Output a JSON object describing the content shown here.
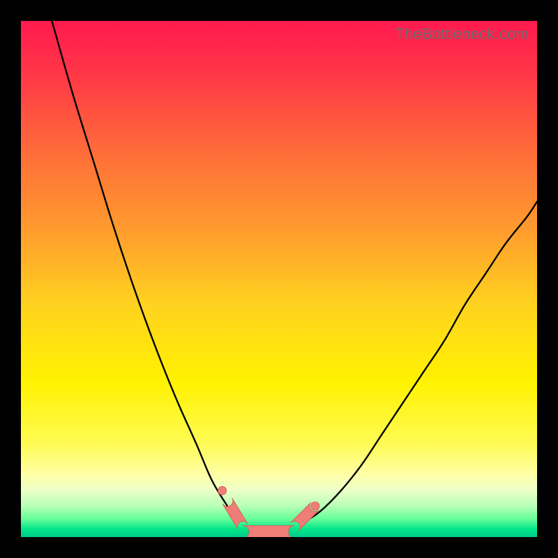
{
  "watermark": "TheBottleneck.com",
  "colors": {
    "frame": "#000000",
    "curve": "#000000",
    "sausage_fill": "#ef7d78",
    "sausage_stroke": "#d85f56",
    "gradient_stops": [
      {
        "offset": 0.0,
        "color": "#ff1a4f"
      },
      {
        "offset": 0.1,
        "color": "#ff3647"
      },
      {
        "offset": 0.25,
        "color": "#ff6b3a"
      },
      {
        "offset": 0.4,
        "color": "#ff9a2e"
      },
      {
        "offset": 0.55,
        "color": "#ffd21f"
      },
      {
        "offset": 0.7,
        "color": "#fff200"
      },
      {
        "offset": 0.82,
        "color": "#fffb55"
      },
      {
        "offset": 0.88,
        "color": "#ffffa8"
      },
      {
        "offset": 0.91,
        "color": "#ecffc8"
      },
      {
        "offset": 0.94,
        "color": "#b6ffb6"
      },
      {
        "offset": 0.965,
        "color": "#66ff99"
      },
      {
        "offset": 0.985,
        "color": "#00e58a"
      },
      {
        "offset": 1.0,
        "color": "#00cc8a"
      }
    ]
  },
  "chart_data": {
    "type": "line",
    "title": "",
    "xlabel": "",
    "ylabel": "",
    "xlim": [
      0,
      100
    ],
    "ylim": [
      0,
      100
    ],
    "series": [
      {
        "name": "left-curve",
        "x": [
          6,
          10,
          14,
          18,
          22,
          26,
          30,
          34,
          37,
          40,
          42
        ],
        "y": [
          100,
          86,
          73,
          60,
          48,
          37,
          27,
          18,
          11,
          6,
          3
        ]
      },
      {
        "name": "right-curve",
        "x": [
          55,
          58,
          62,
          66,
          70,
          74,
          78,
          82,
          86,
          90,
          94,
          98,
          100
        ],
        "y": [
          3,
          5,
          9,
          14,
          20,
          26,
          32,
          38,
          45,
          51,
          57,
          62,
          65
        ]
      }
    ],
    "markers": [
      {
        "name": "left-end-cluster",
        "x": 42,
        "y": 3
      },
      {
        "name": "floor-sausage",
        "x": 48,
        "y": 1
      },
      {
        "name": "right-start-cluster",
        "x": 55,
        "y": 3
      },
      {
        "name": "stray-dot",
        "x": 57,
        "y": 6
      }
    ],
    "floor_band_y": [
      0,
      4
    ]
  }
}
